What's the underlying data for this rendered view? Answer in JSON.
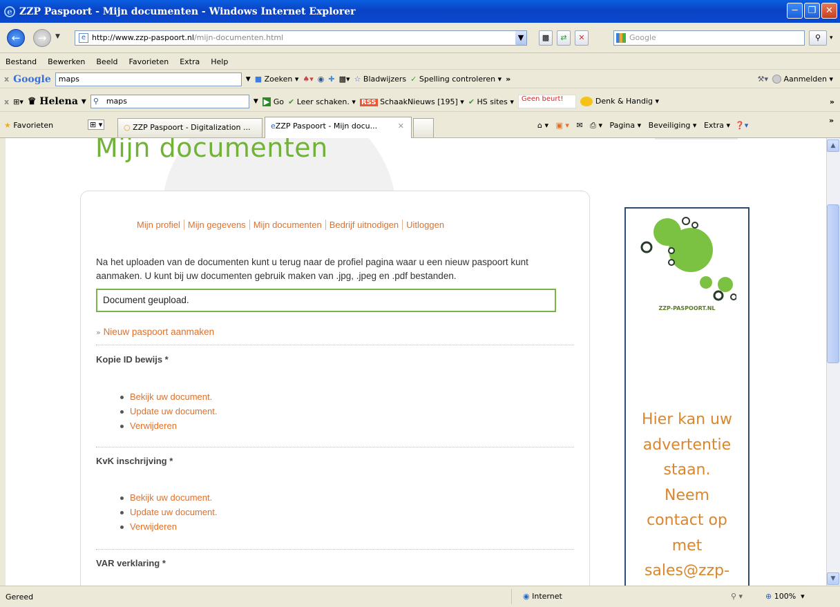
{
  "window": {
    "title": "ZZP Paspoort - Mijn documenten - Windows Internet Explorer"
  },
  "address": {
    "url_domain": "http://www.zzp-paspoort.nl",
    "url_path": "/mijn-documenten.html",
    "search_placeholder": "Google"
  },
  "menu": [
    "Bestand",
    "Bewerken",
    "Beeld",
    "Favorieten",
    "Extra",
    "Help"
  ],
  "google_toolbar": {
    "brand": "Google",
    "query": "maps",
    "search_label": "Zoeken",
    "bookmarks_label": "Bladwijzers",
    "spelling_label": "Spelling controleren",
    "more": "»",
    "signin_label": "Aanmelden"
  },
  "helena_toolbar": {
    "brand": "Helena",
    "query": "maps",
    "go_label": "Go",
    "chess_label": "Leer schaken.",
    "rss_badge": "RSS",
    "news_label": "SchaakNieuws [195]",
    "hs_label": "HS sites",
    "geen_beurt": "Geen beurt!",
    "denk_label": "Denk & Handig",
    "more": "»"
  },
  "tabs_bar": {
    "favorites_label": "Favorieten",
    "tabs": [
      "ZZP Paspoort - Digitalization ...",
      "ZZP Paspoort - Mijn docu..."
    ],
    "tools": [
      "Pagina",
      "Beveiliging",
      "Extra"
    ],
    "more": "»"
  },
  "page": {
    "heading": "Mijn documenten",
    "nav": [
      "Mijn profiel",
      "Mijn gegevens",
      "Mijn documenten",
      "Bedrijf uitnodigen",
      "Uitloggen"
    ],
    "intro_line1": "Na het uploaden van de documenten kunt u terug naar de profiel pagina waar u een nieuw paspoort kunt",
    "intro_line2": "aanmaken. U kunt bij uw documenten gebruik maken van .jpg, .jpeg en .pdf bestanden.",
    "alert": "Document geupload.",
    "new_passport_prefix": "»",
    "new_passport_link": "Nieuw paspoort aanmaken",
    "sections": [
      {
        "title": "Kopie ID bewijs *",
        "links": [
          "Bekijk uw document.",
          "Update uw document.",
          "Verwijderen"
        ]
      },
      {
        "title": "KvK inschrijving *",
        "links": [
          "Bekijk uw document.",
          "Update uw document.",
          "Verwijderen"
        ]
      },
      {
        "title": "VAR verklaring *"
      }
    ],
    "ad": {
      "logo_text": "ZZP-PASPOORT.NL",
      "lines": [
        "Hier kan uw",
        "advertentie",
        "staan.",
        "Neem",
        "contact op",
        "met",
        "sales@zzp-"
      ]
    }
  },
  "status": {
    "text": "Gereed",
    "zone": "Internet",
    "zoom": "100%"
  },
  "colors": {
    "accent_green": "#72b23a",
    "link_orange": "#e0702a",
    "ad_orange": "#d9862d",
    "xp_blue": "#0a43c4"
  }
}
